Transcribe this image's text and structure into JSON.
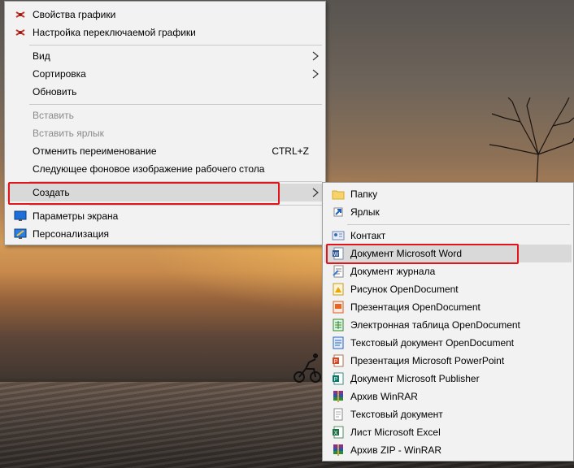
{
  "main_menu": {
    "items": [
      {
        "label": "Свойства графики",
        "icon": "intel-graphics-icon",
        "enabled": true
      },
      {
        "label": "Настройка переключаемой графики",
        "icon": "intel-graphics-icon",
        "enabled": true
      },
      {
        "label": "Вид",
        "submenu": true,
        "enabled": true
      },
      {
        "label": "Сортировка",
        "submenu": true,
        "enabled": true
      },
      {
        "label": "Обновить",
        "enabled": true
      },
      {
        "label": "Вставить",
        "enabled": false
      },
      {
        "label": "Вставить ярлык",
        "enabled": false
      },
      {
        "label": "Отменить переименование",
        "shortcut": "CTRL+Z",
        "enabled": true
      },
      {
        "label": "Следующее фоновое изображение рабочего стола",
        "enabled": true
      },
      {
        "label": "Создать",
        "submenu": true,
        "enabled": true,
        "highlighted": true
      },
      {
        "label": "Параметры экрана",
        "icon": "display-settings-icon",
        "enabled": true
      },
      {
        "label": "Персонализация",
        "icon": "personalization-icon",
        "enabled": true
      }
    ]
  },
  "sub_menu": {
    "items": [
      {
        "label": "Папку",
        "icon": "folder-icon"
      },
      {
        "label": "Ярлык",
        "icon": "shortcut-icon"
      },
      {
        "label": "Контакт",
        "icon": "contact-icon"
      },
      {
        "label": "Документ Microsoft Word",
        "icon": "word-document-icon",
        "highlighted": true
      },
      {
        "label": "Документ журнала",
        "icon": "journal-document-icon"
      },
      {
        "label": "Рисунок OpenDocument",
        "icon": "opendocument-drawing-icon"
      },
      {
        "label": "Презентация OpenDocument",
        "icon": "opendocument-presentation-icon"
      },
      {
        "label": "Электронная таблица OpenDocument",
        "icon": "opendocument-spreadsheet-icon"
      },
      {
        "label": "Текстовый документ OpenDocument",
        "icon": "opendocument-text-icon"
      },
      {
        "label": "Презентация Microsoft PowerPoint",
        "icon": "powerpoint-icon"
      },
      {
        "label": "Документ Microsoft Publisher",
        "icon": "publisher-icon"
      },
      {
        "label": "Архив WinRAR",
        "icon": "winrar-archive-icon"
      },
      {
        "label": "Текстовый документ",
        "icon": "text-document-icon"
      },
      {
        "label": "Лист Microsoft Excel",
        "icon": "excel-icon"
      },
      {
        "label": "Архив ZIP - WinRAR",
        "icon": "winrar-zip-icon"
      }
    ]
  },
  "colors": {
    "menu_bg": "#f2f2f2",
    "highlight_bg": "#d9d9d9",
    "disabled_text": "#8a8a8a",
    "annotation_red": "#e0161b"
  }
}
